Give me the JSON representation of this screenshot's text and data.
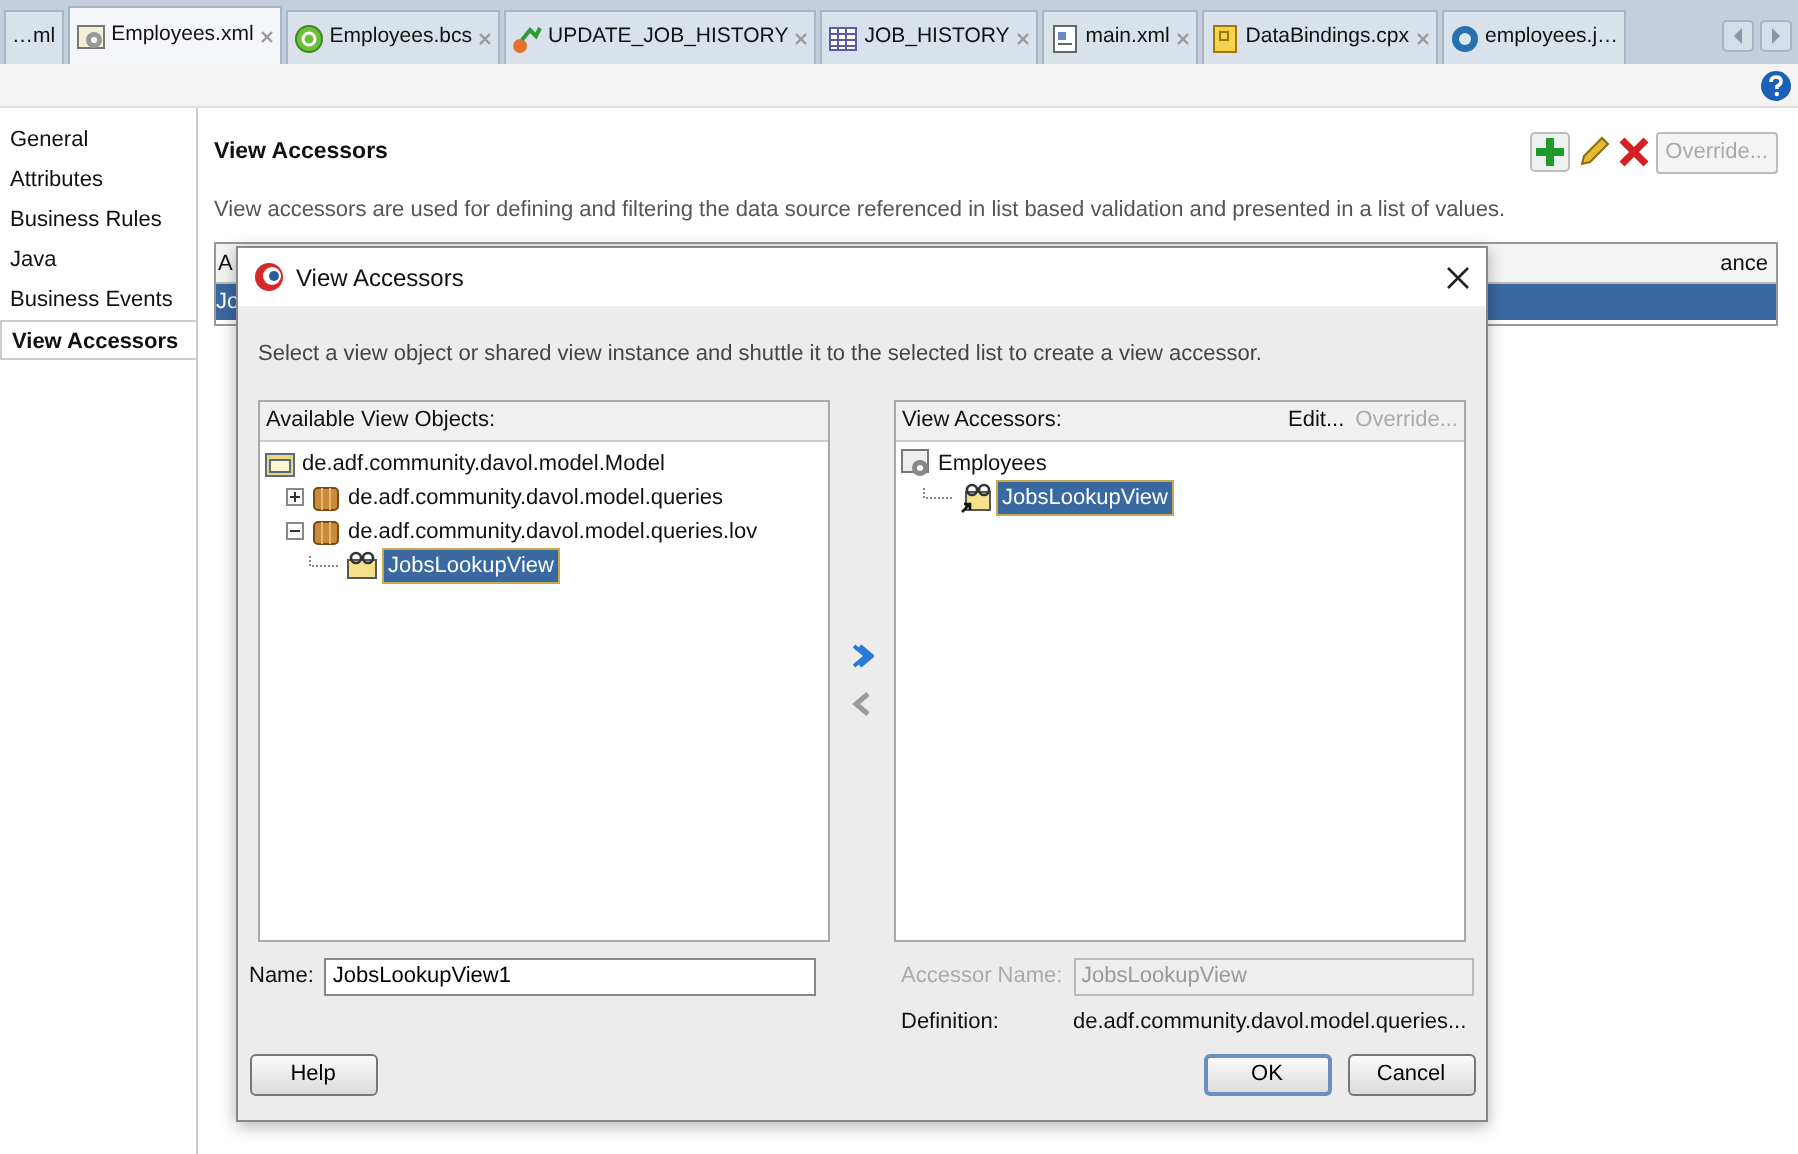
{
  "tabs": [
    {
      "label": "…ml",
      "kind": "plain",
      "selected": false,
      "closable": false
    },
    {
      "label": "Employees.xml",
      "kind": "gear",
      "selected": true,
      "closable": true
    },
    {
      "label": "Employees.bcs",
      "kind": "circle",
      "selected": false,
      "closable": true
    },
    {
      "label": "UPDATE_JOB_HISTORY",
      "kind": "trigger",
      "selected": false,
      "closable": true
    },
    {
      "label": "JOB_HISTORY",
      "kind": "grid",
      "selected": false,
      "closable": true
    },
    {
      "label": "main.xml",
      "kind": "page",
      "selected": false,
      "closable": true
    },
    {
      "label": "DataBindings.cpx",
      "kind": "binding",
      "selected": false,
      "closable": true
    },
    {
      "label": "employees.j…",
      "kind": "globe",
      "selected": false,
      "closable": false
    }
  ],
  "sidebar": {
    "items": [
      {
        "label": "General",
        "selected": false
      },
      {
        "label": "Attributes",
        "selected": false
      },
      {
        "label": "Business Rules",
        "selected": false
      },
      {
        "label": "Java",
        "selected": false
      },
      {
        "label": "Business Events",
        "selected": false
      },
      {
        "label": "View Accessors",
        "selected": true
      }
    ]
  },
  "main": {
    "title": "View Accessors",
    "description": "View accessors are used for defining and filtering the data source referenced in list based validation and presented in a list of values.",
    "override_button": {
      "label": "Override...",
      "disabled": true
    },
    "table": {
      "columns": [
        "A",
        "ance"
      ],
      "rows": [
        {
          "cells": [
            "Jo"
          ],
          "selected": true
        }
      ]
    }
  },
  "dialog": {
    "title": "View Accessors",
    "instruction": "Select a view object or shared view instance and shuttle it to the selected list to create a view accessor.",
    "available": {
      "header": "Available View Objects:",
      "tree": [
        {
          "label": "de.adf.community.davol.model.Model",
          "kind": "folder",
          "selected": false,
          "children": [
            {
              "label": "de.adf.community.davol.model.queries",
              "kind": "package",
              "expanded": false,
              "selected": false
            },
            {
              "label": "de.adf.community.davol.model.queries.lov",
              "kind": "package",
              "expanded": true,
              "selected": false,
              "children": [
                {
                  "label": "JobsLookupView",
                  "kind": "view",
                  "selected": true
                }
              ]
            }
          ]
        }
      ]
    },
    "name": {
      "label": "Name:",
      "value": "JobsLookupView1"
    },
    "shuttle": [
      {
        "kind": "add",
        "disabled": false
      },
      {
        "kind": "remove",
        "disabled": true
      }
    ],
    "accessors": {
      "header": "View Accessors:",
      "actions": [
        {
          "label": "Edit...",
          "disabled": false
        },
        {
          "label": "Override...",
          "disabled": true
        }
      ],
      "tree": [
        {
          "label": "Employees",
          "kind": "entity",
          "selected": false,
          "children": [
            {
              "label": "JobsLookupView",
              "kind": "accessor",
              "selected": true
            }
          ]
        }
      ]
    },
    "accessor_name": {
      "label": "Accessor Name:",
      "value": "JobsLookupView",
      "disabled": true
    },
    "definition": {
      "label": "Definition:",
      "value": "de.adf.community.davol.model.queries..."
    },
    "buttons": [
      {
        "label": "Help",
        "default": false
      },
      {
        "label": "OK",
        "default": true
      },
      {
        "label": "Cancel",
        "default": false
      }
    ]
  }
}
